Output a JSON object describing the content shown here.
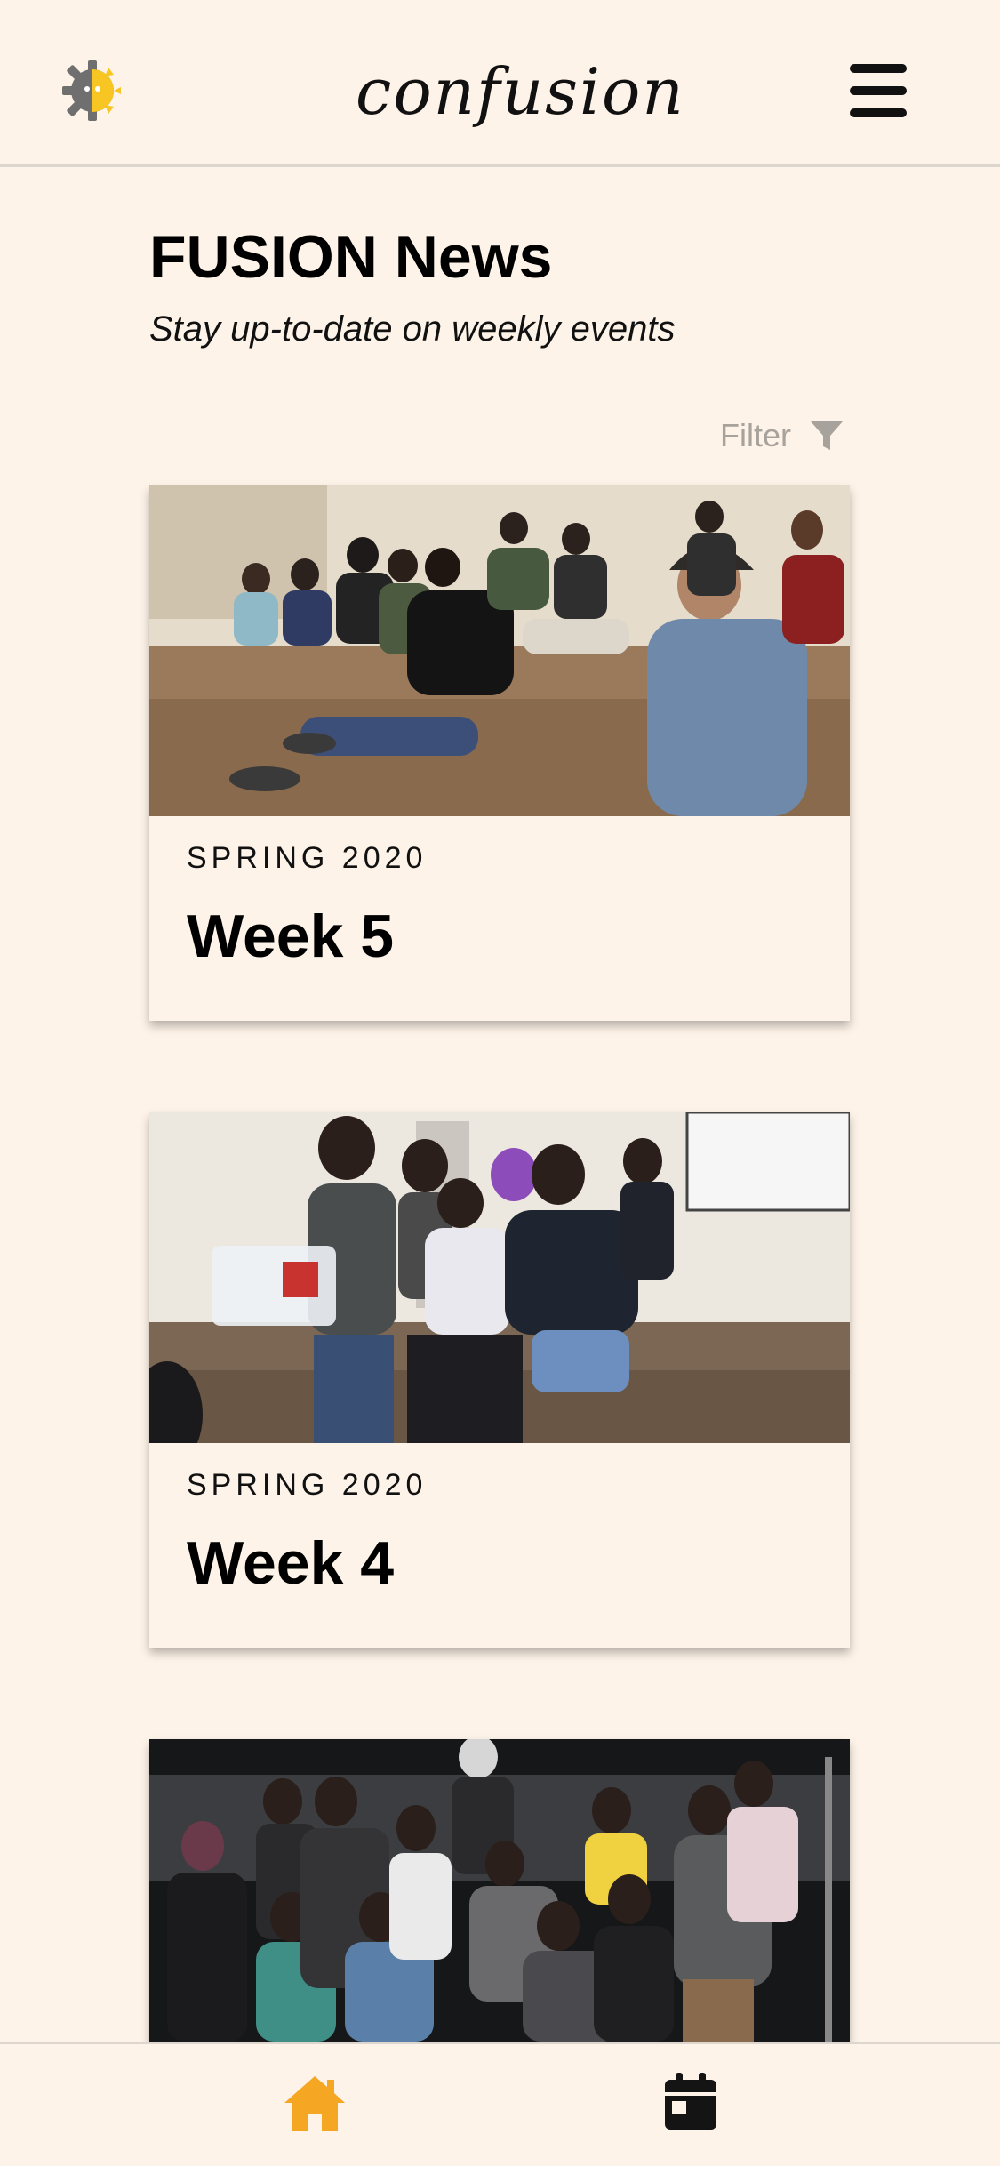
{
  "header": {
    "logo_text": "confusion",
    "settings_icon": "gear-sun-icon",
    "menu_icon": "hamburger-menu-icon"
  },
  "main": {
    "title": "FUSION News",
    "subtitle": "Stay up-to-date on weekly events",
    "filter_label": "Filter",
    "filter_icon": "funnel-icon",
    "cards": [
      {
        "season": "SPRING 2020",
        "title": "Week 5"
      },
      {
        "season": "SPRING 2020",
        "title": "Week 4"
      }
    ]
  },
  "bottom_nav": {
    "items": [
      {
        "icon": "home-icon",
        "active": true
      },
      {
        "icon": "calendar-icon",
        "active": false
      }
    ]
  },
  "colors": {
    "background": "#fdf3e8",
    "accent": "#f5a623",
    "text": "#000000",
    "muted": "#a7a29b"
  }
}
